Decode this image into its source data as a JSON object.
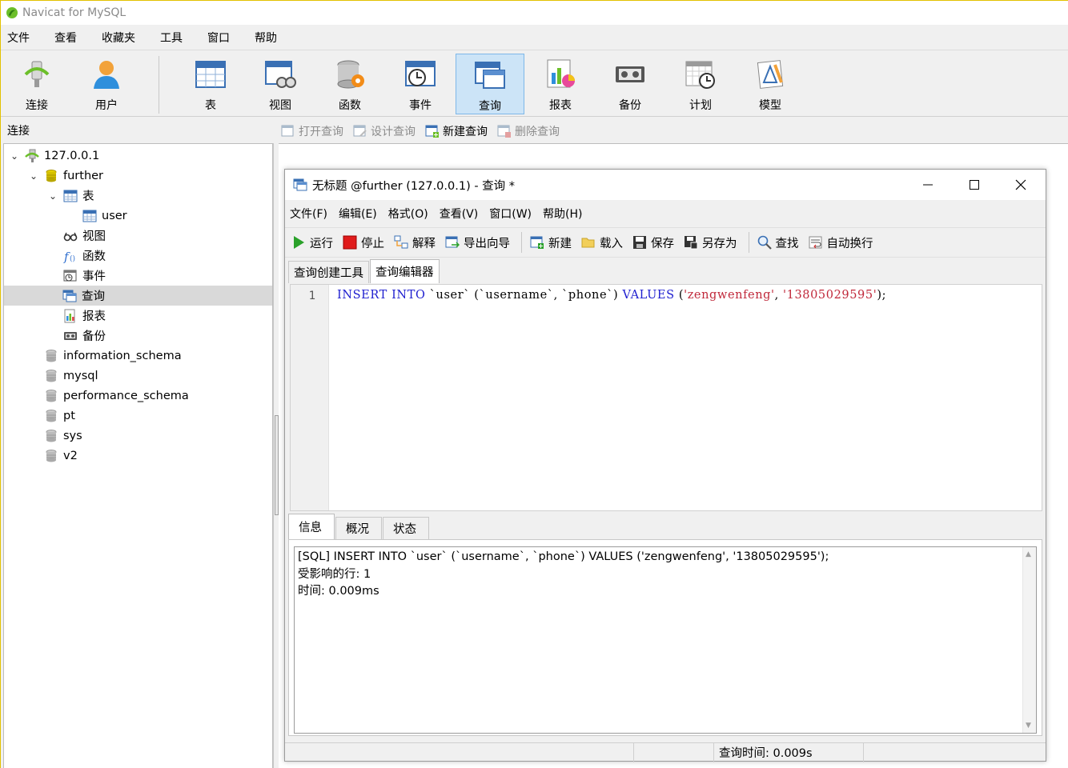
{
  "app": {
    "title": "Navicat for MySQL"
  },
  "menu": [
    "文件",
    "查看",
    "收藏夹",
    "工具",
    "窗口",
    "帮助"
  ],
  "toolbar": {
    "connect": "连接",
    "user": "用户",
    "table": "表",
    "view": "视图",
    "function": "函数",
    "event": "事件",
    "query": "查询",
    "report": "报表",
    "backup": "备份",
    "schedule": "计划",
    "model": "模型",
    "active": "查询"
  },
  "left_panel": {
    "header": "连接"
  },
  "tree": {
    "connection": "127.0.0.1",
    "db_open": "further",
    "tables_group": "表",
    "table_user": "user",
    "views": "视图",
    "functions": "函数",
    "events": "事件",
    "queries": "查询",
    "reports": "报表",
    "backups": "备份",
    "other_dbs": [
      "information_schema",
      "mysql",
      "performance_schema",
      "pt",
      "sys",
      "v2"
    ]
  },
  "object_toolbar": {
    "open": "打开查询",
    "design": "设计查询",
    "new": "新建查询",
    "delete": "删除查询"
  },
  "query_window": {
    "title": "无标题 @further (127.0.0.1) - 查询 *",
    "menu": [
      "文件(F)",
      "编辑(E)",
      "格式(O)",
      "查看(V)",
      "窗口(W)",
      "帮助(H)"
    ],
    "toolbar": {
      "run": "运行",
      "stop": "停止",
      "explain": "解释",
      "export_wizard": "导出向导",
      "new": "新建",
      "load": "载入",
      "save": "保存",
      "save_as": "另存为",
      "find": "查找",
      "word_wrap": "自动换行"
    },
    "tabs": [
      "查询创建工具",
      "查询编辑器"
    ],
    "active_tab": "查询编辑器",
    "editor": {
      "line_number": "1",
      "code": {
        "kw1": "INSERT",
        "kw2": "INTO",
        "ident": " `user` (`username`, `phone`) ",
        "kw3": "VALUES",
        "lp": " (",
        "s1": "'zengwenfeng'",
        "comma": ", ",
        "s2": "'13805029595'",
        "end": ");"
      }
    },
    "result_tabs": [
      "信息",
      "概况",
      "状态"
    ],
    "active_result_tab": "信息",
    "messages": [
      "[SQL] INSERT INTO `user` (`username`, `phone`) VALUES ('zengwenfeng', '13805029595');",
      "受影响的行: 1",
      "时间: 0.009ms"
    ],
    "status": {
      "query_time": "查询时间: 0.009s"
    }
  },
  "colors": {
    "accent_active": "#cce4f7",
    "keyword": "#2020d0",
    "string": "#c0283a",
    "db_icon": "#c8b400"
  }
}
